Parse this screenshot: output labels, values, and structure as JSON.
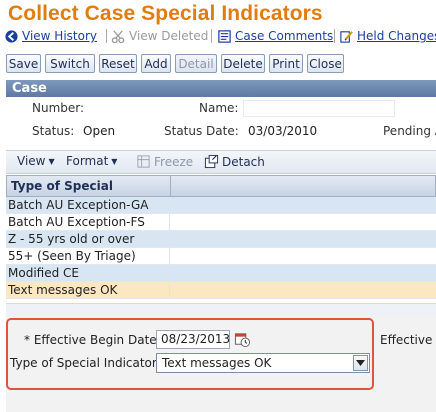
{
  "page": {
    "title": "Collect Case Special Indicators"
  },
  "links": [
    {
      "label": "View History",
      "icon": "back-arrow-icon",
      "disabled": false
    },
    {
      "label": "View Deleted",
      "icon": "scissors-icon",
      "disabled": true
    },
    {
      "label": "Case Comments",
      "icon": "document-icon",
      "disabled": false
    },
    {
      "label": "Held Changes",
      "icon": "pencil-icon",
      "disabled": false
    }
  ],
  "toolbar": {
    "save": "Save",
    "switch": "Switch",
    "reset": "Reset",
    "add": "Add",
    "detail": "Detail",
    "delete": "Delete",
    "print": "Print",
    "close": "Close"
  },
  "case": {
    "header": "Case",
    "number_label": "Number:",
    "name_label": "Name:",
    "status_label": "Status:",
    "status_value": "Open",
    "status_date_label": "Status Date:",
    "status_date_value": "03/03/2010",
    "pending_label": "Pending A"
  },
  "table_toolbar": {
    "view": "View",
    "format": "Format",
    "freeze": "Freeze",
    "detach": "Detach"
  },
  "grid": {
    "header": "Type of Special Indicator",
    "rows": [
      "Batch AU Exception-GA",
      "Batch AU Exception-FS",
      "Z - 55 yrs old or over",
      "55+ (Seen By Triage)",
      "Modified CE",
      "Text messages OK"
    ],
    "selected_index": 5
  },
  "form": {
    "effective_begin_label": "* Effective Begin Date:",
    "effective_begin_value": "08/23/2013",
    "type_label": "Type of Special Indicator:",
    "type_value": "Text messages OK",
    "effective_end_label": "Effective E"
  },
  "colors": {
    "title": "#e07d10",
    "link": "#1a3fa0",
    "header_bg": "#6a86ae",
    "highlight": "#e0533c",
    "selected_row": "#fbe7c0",
    "alt_row": "#d8e6f3"
  }
}
